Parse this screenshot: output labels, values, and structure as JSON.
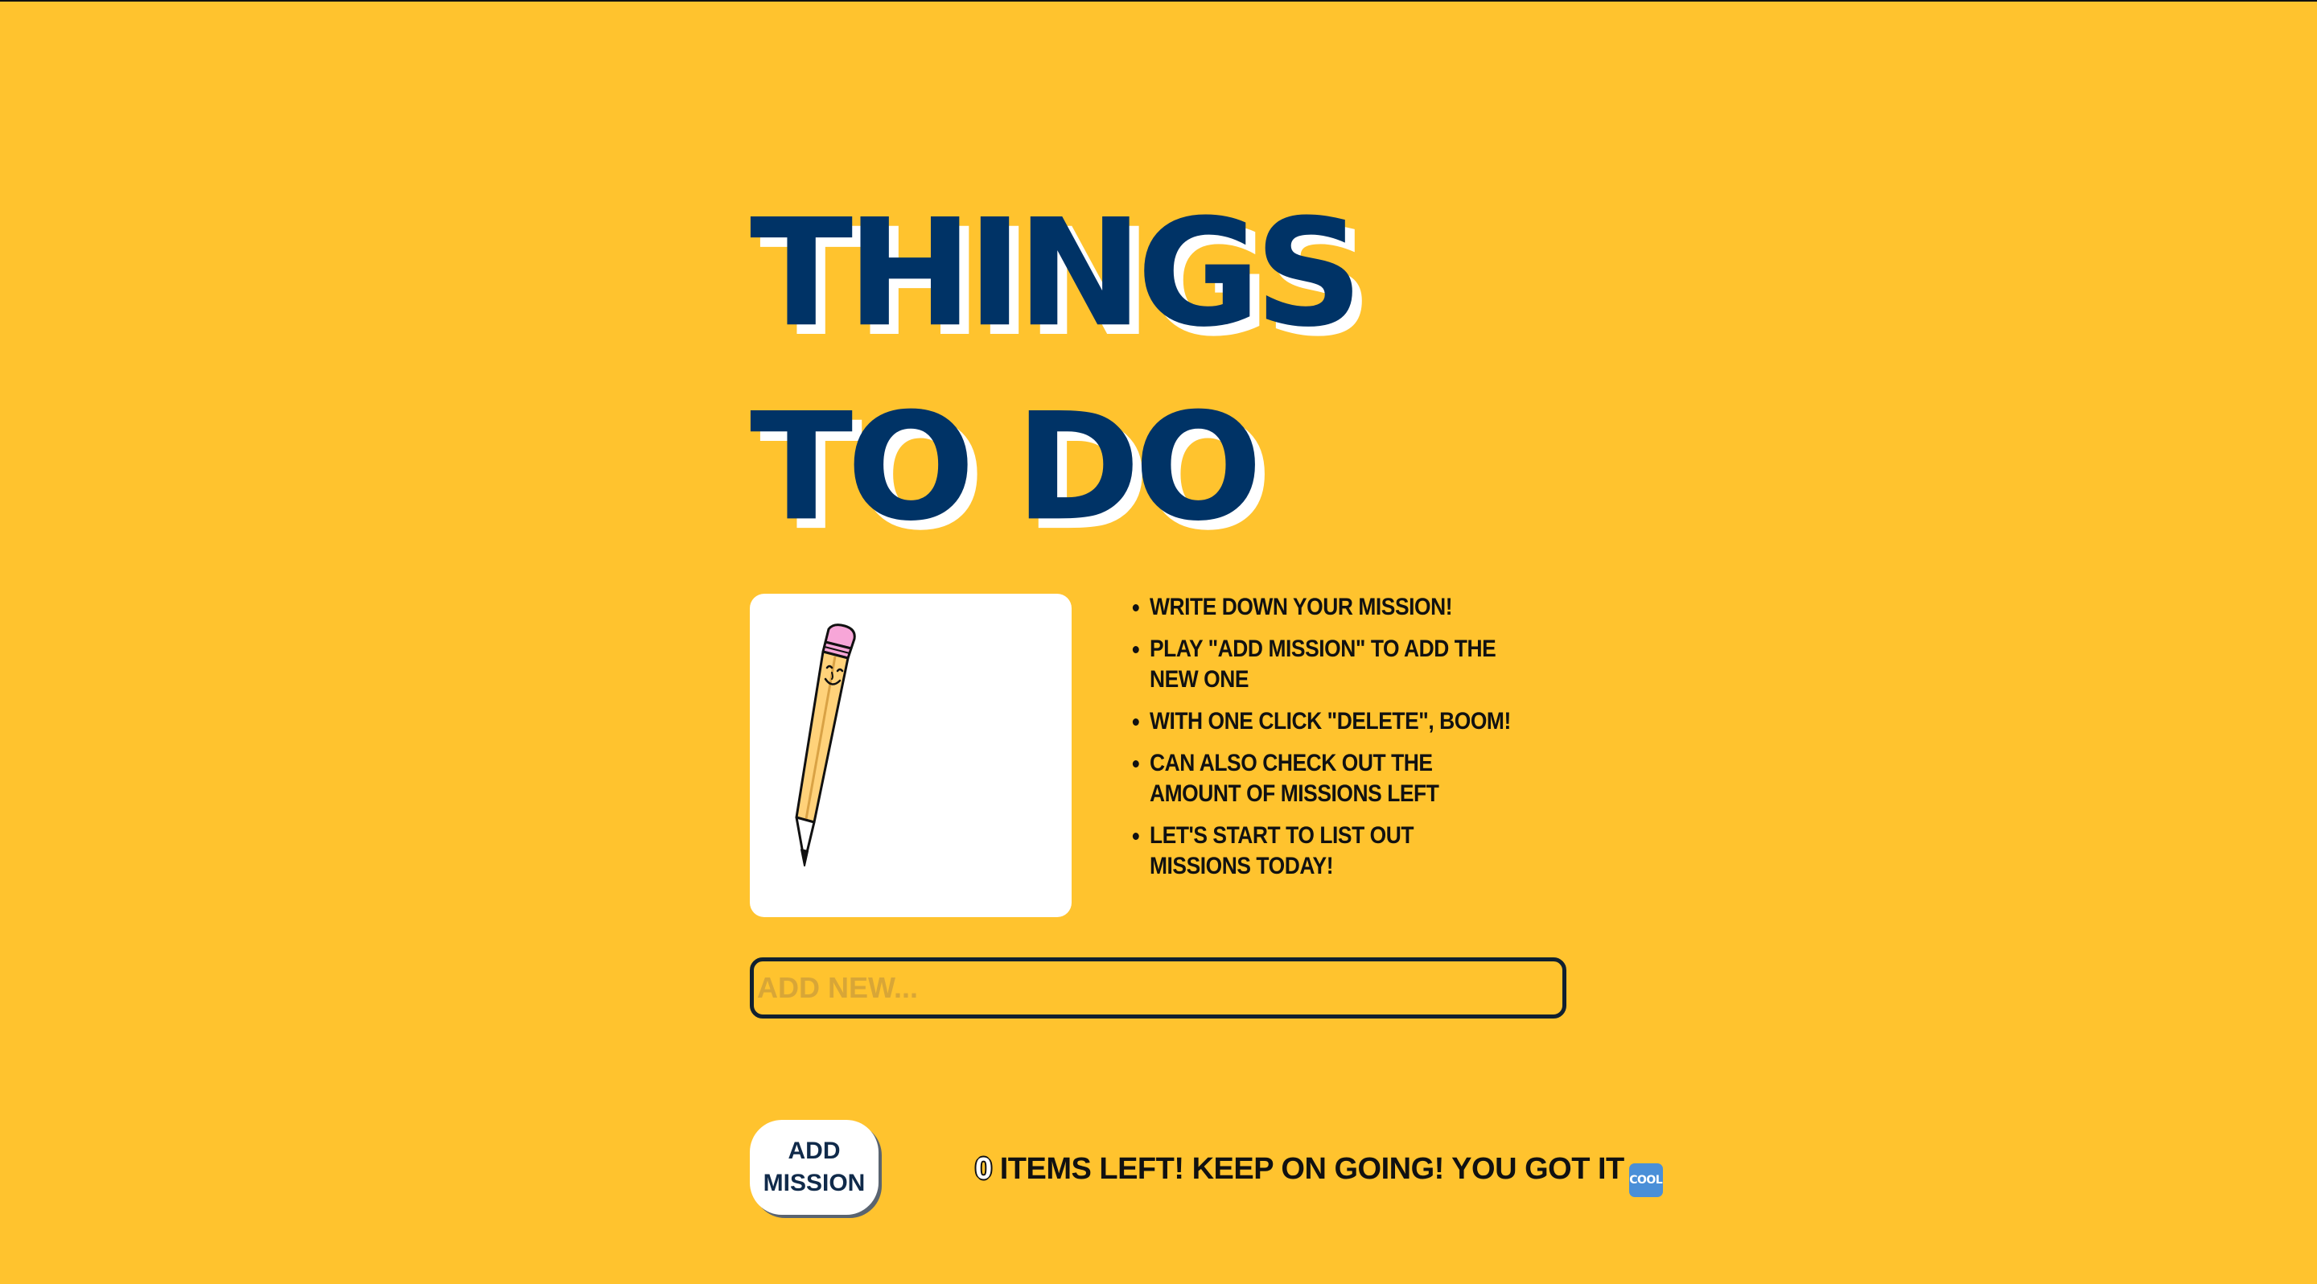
{
  "header": {
    "title": "THINGS TO DO"
  },
  "instructions": [
    "WRITE DOWN YOUR MISSION!",
    "PLAY \"ADD MISSION\" TO ADD THE NEW ONE",
    "WITH ONE CLICK \"DELETE\", BOOM!",
    "CAN ALSO CHECK OUT THE AMOUNT OF MISSIONS LEFT",
    "LET'S START TO LIST OUT MISSIONS TODAY!"
  ],
  "input": {
    "placeholder": "ADD NEW...",
    "value": ""
  },
  "add_button": {
    "label": "ADD MISSION"
  },
  "status": {
    "count": "0",
    "message": " ITEMS LEFT! KEEP ON GOING! YOU GOT IT",
    "icon": "cool-icon",
    "icon_text": "COOL"
  },
  "colors": {
    "background": "#ffc32e",
    "title": "#003366",
    "title_shadow": "#ffffff",
    "card": "#ffffff",
    "input_border": "#102030",
    "pencil_body": "#ffd27a",
    "pencil_eraser": "#f7a6d8"
  },
  "illustration": {
    "icon": "pencil-icon"
  }
}
